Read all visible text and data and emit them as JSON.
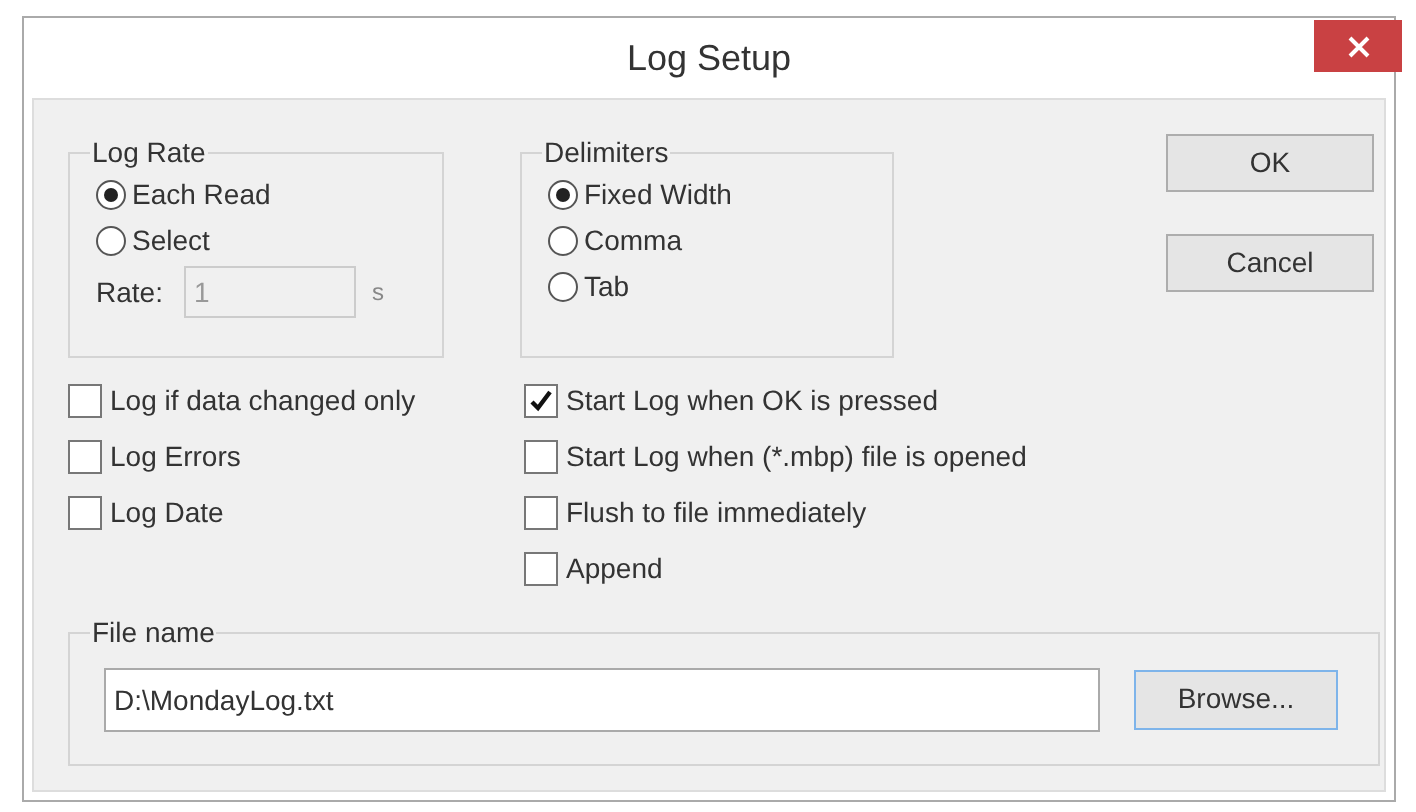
{
  "window": {
    "title": "Log Setup"
  },
  "log_rate": {
    "title": "Log Rate",
    "options": [
      {
        "label": "Each Read",
        "selected": true
      },
      {
        "label": "Select",
        "selected": false
      }
    ],
    "rate_label": "Rate:",
    "rate_value": "1",
    "rate_unit": "s",
    "rate_disabled": true
  },
  "delimiters": {
    "title": "Delimiters",
    "options": [
      {
        "label": "Fixed Width",
        "selected": true
      },
      {
        "label": "Comma",
        "selected": false
      },
      {
        "label": "Tab",
        "selected": false
      }
    ]
  },
  "buttons": [
    {
      "label": "OK"
    },
    {
      "label": "Cancel"
    }
  ],
  "left_checks": [
    {
      "label": "Log if data changed only",
      "checked": false
    },
    {
      "label": "Log Errors",
      "checked": false
    },
    {
      "label": "Log Date",
      "checked": false
    }
  ],
  "right_checks": [
    {
      "label": "Start Log when OK is pressed",
      "checked": true
    },
    {
      "label": "Start Log when (*.mbp) file is opened",
      "checked": false
    },
    {
      "label": "Flush to file immediately",
      "checked": false
    },
    {
      "label": "Append",
      "checked": false
    }
  ],
  "file": {
    "title": "File name",
    "value": "D:\\MondayLog.txt",
    "button": "Browse..."
  }
}
